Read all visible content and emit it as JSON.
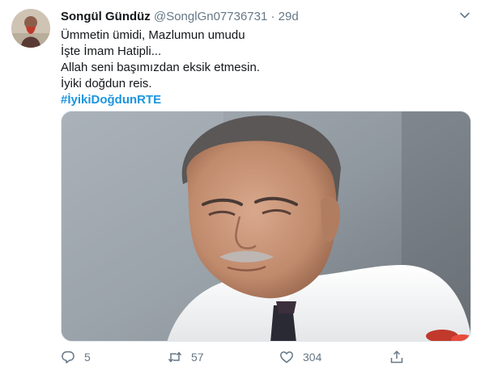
{
  "tweet": {
    "display_name": "Songül Gündüz",
    "handle": "@SonglGn07736731",
    "separator": "·",
    "time": "29d",
    "lines": [
      "Ümmetin ümidi, Mazlumun umudu",
      "İşte İmam Hatipli...",
      "Allah seni başımızdan eksik etmesin.",
      "İyiki doğdun reis."
    ],
    "hashtag": "#İyikiDoğdunRTE"
  },
  "actions": {
    "reply_count": "5",
    "retweet_count": "57",
    "like_count": "304"
  },
  "icons": [
    "avatar",
    "chevron-down-icon",
    "reply-icon",
    "retweet-icon",
    "like-icon",
    "share-icon"
  ],
  "colors": {
    "name": "#14171a",
    "secondary": "#657786",
    "hashtag": "#1b95e0"
  }
}
